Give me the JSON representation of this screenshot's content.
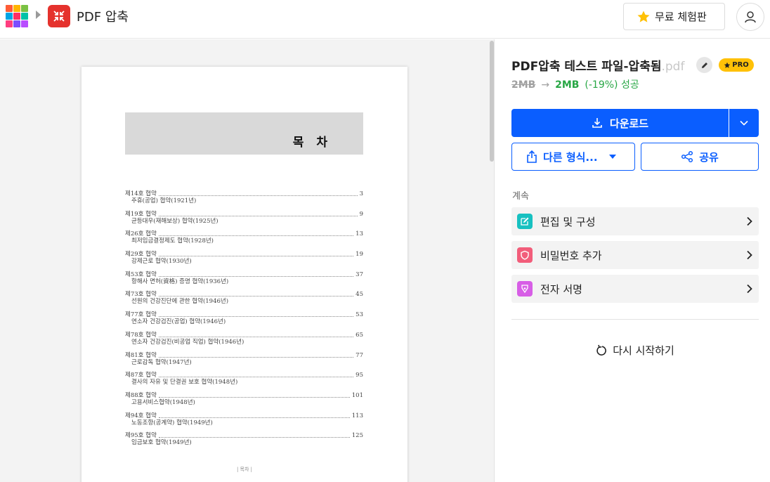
{
  "header": {
    "app_title": "PDF 압축",
    "trial_label": "무료 체험판",
    "logo_colors": [
      "#ff5c35",
      "#ffb400",
      "#7ac143",
      "#00a4e4",
      "#ff2e63",
      "#00c2a8",
      "#ff3d7f",
      "#7b4dff",
      "#b84dff"
    ],
    "app_icon_color": "#e5322d"
  },
  "document": {
    "toc_title": "목 차",
    "entries": [
      {
        "title": "제14호 협약",
        "page": "3",
        "subtitle": "주휴(공업) 협약(1921년)"
      },
      {
        "title": "제19호 협약",
        "page": "9",
        "subtitle": "균등대우(재해보상) 협약(1925년)"
      },
      {
        "title": "제26호 협약",
        "page": "13",
        "subtitle": "최저임금결정제도 협약(1928년)"
      },
      {
        "title": "제29호 협약",
        "page": "19",
        "subtitle": "강제근로 협약(1930년)"
      },
      {
        "title": "제53호 협약",
        "page": "37",
        "subtitle": "항해사 면허(資格) 증명 협약(1936년)"
      },
      {
        "title": "제73호 협약",
        "page": "45",
        "subtitle": "선원의 건강진단에 관한 협약(1946년)"
      },
      {
        "title": "제77호 협약",
        "page": "53",
        "subtitle": "연소자 건강검진(공업) 협약(1946년)"
      },
      {
        "title": "제78호 협약",
        "page": "65",
        "subtitle": "연소자 건강검진(비공업 직업) 협약(1946년)"
      },
      {
        "title": "제81호 협약",
        "page": "77",
        "subtitle": "근로감독 협약(1947년)"
      },
      {
        "title": "제87호 협약",
        "page": "95",
        "subtitle": "결사의 자유 및 단결권 보호 협약(1948년)"
      },
      {
        "title": "제88호 협약",
        "page": "101",
        "subtitle": "고용서비스협약(1948년)"
      },
      {
        "title": "제94호 협약",
        "page": "113",
        "subtitle": "노동조항(공계약) 협약(1949년)"
      },
      {
        "title": "제95호 협약",
        "page": "125",
        "subtitle": "임금보호 협약(1949년)"
      }
    ],
    "footer": "| 목차 |"
  },
  "panel": {
    "file_name": "PDF압축 테스트 파일-압축됨",
    "file_ext": ".pdf",
    "pro_label": "PRO",
    "size_before": "2MB",
    "size_arrow": "→",
    "size_after": "2MB",
    "size_change": "(-19%) 성공",
    "download_label": "다운로드",
    "convert_label": "다른 형식...",
    "share_label": "공유",
    "continue_label": "계속",
    "actions": [
      {
        "label": "편집 및 구성",
        "icon": "edit-icon",
        "color": "#17c1c1"
      },
      {
        "label": "비밀번호 추가",
        "icon": "shield-icon",
        "color": "#f25d7a"
      },
      {
        "label": "전자 서명",
        "icon": "pen-nib-icon",
        "color": "#d75ee6"
      }
    ],
    "restart_label": "다시 시작하기",
    "accent_color": "#0a5eff",
    "success_color": "#28a745"
  }
}
